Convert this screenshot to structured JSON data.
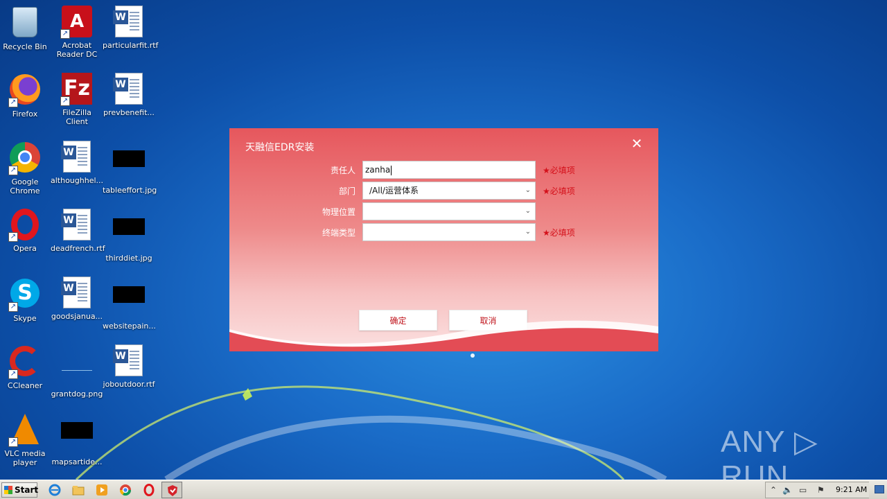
{
  "desktop": {
    "icons": [
      {
        "label": "Recycle Bin"
      },
      {
        "label": "Acrobat Reader DC"
      },
      {
        "label": "particularfit.rtf"
      },
      {
        "label": "Firefox"
      },
      {
        "label": "FileZilla Client"
      },
      {
        "label": "prevbenefit..."
      },
      {
        "label": "Google Chrome"
      },
      {
        "label": "althoughhel..."
      },
      {
        "label": "tableeffort.jpg"
      },
      {
        "label": "Opera"
      },
      {
        "label": "deadfrench.rtf"
      },
      {
        "label": "thirddiet.jpg"
      },
      {
        "label": "Skype"
      },
      {
        "label": "goodsjanua..."
      },
      {
        "label": "websitepain..."
      },
      {
        "label": "CCleaner"
      },
      {
        "label": "grantdog.png"
      },
      {
        "label": "joboutdoor.rtf"
      },
      {
        "label": "VLC media player"
      },
      {
        "label": "mapsartide..."
      }
    ]
  },
  "dialog": {
    "title": "天融信EDR安装",
    "close_glyph": "✕",
    "fields": [
      {
        "label": "责任人",
        "value": "zanha",
        "required": true
      },
      {
        "label": "部门",
        "value": "/All/运营体系",
        "required": true
      },
      {
        "label": "物理位置",
        "value": "",
        "required": false
      },
      {
        "label": "终端类型",
        "value": "",
        "required": true
      }
    ],
    "required_text": "★必填项",
    "ok_label": "确定",
    "cancel_label": "取消",
    "chevron": "⌄"
  },
  "watermark": "ANY ▷ RUN",
  "taskbar": {
    "start_label": "Start",
    "clock": "9:21 AM",
    "pinned": [
      "ie-icon",
      "explorer-icon",
      "media-player-icon",
      "chrome-icon",
      "opera-icon",
      "edr-installer-icon"
    ]
  },
  "colors": {
    "dialog_top": "#e6575d",
    "required": "#d4101a",
    "button_text": "#c0141c"
  }
}
